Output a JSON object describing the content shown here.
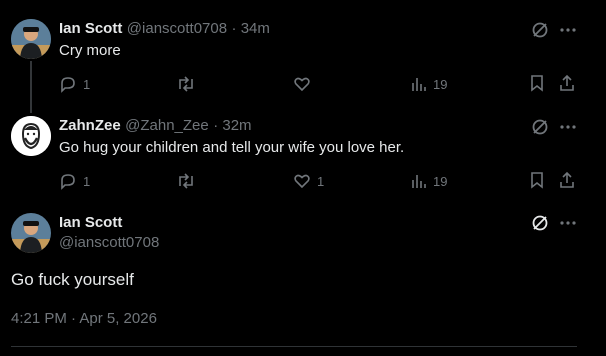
{
  "colors": {
    "background": "#000000",
    "text": "#e7e9ea",
    "muted": "#71767b",
    "divider": "#2f3336"
  },
  "tweets": [
    {
      "name": "Ian Scott",
      "handle": "@ianscott0708",
      "time": "· 34m",
      "text": "Cry more",
      "replies": "1",
      "retweets": "",
      "likes": "",
      "views": "19"
    },
    {
      "name": "ZahnZee",
      "handle": "@Zahn_Zee",
      "time": "· 32m",
      "text": "Go hug your children and tell your wife you love her.",
      "replies": "1",
      "retweets": "",
      "likes": "1",
      "views": "19"
    }
  ],
  "focused": {
    "name": "Ian Scott",
    "handle": "@ianscott0708",
    "text": "Go fuck yourself",
    "timestamp": "4:21 PM · Apr 5, 2026"
  },
  "icons": [
    "grok-icon",
    "more-icon",
    "reply-icon",
    "retweet-icon",
    "like-icon",
    "views-icon",
    "bookmark-icon",
    "share-icon"
  ]
}
